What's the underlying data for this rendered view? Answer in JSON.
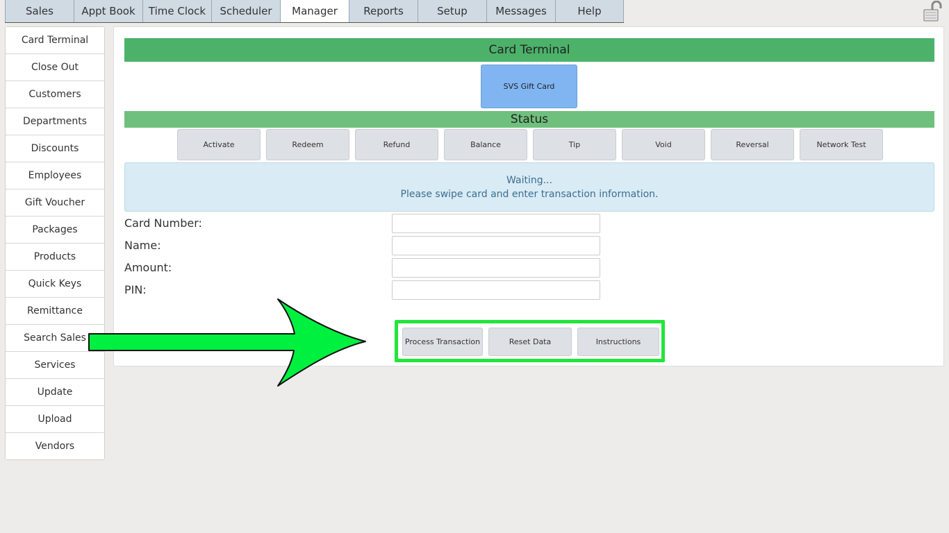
{
  "tabs": [
    {
      "label": "Sales"
    },
    {
      "label": "Appt Book"
    },
    {
      "label": "Time Clock"
    },
    {
      "label": "Scheduler"
    },
    {
      "label": "Manager"
    },
    {
      "label": "Reports"
    },
    {
      "label": "Setup"
    },
    {
      "label": "Messages"
    },
    {
      "label": "Help"
    }
  ],
  "active_tab": "Manager",
  "sidebar": {
    "items": [
      {
        "label": "Card Terminal"
      },
      {
        "label": "Close Out"
      },
      {
        "label": "Customers"
      },
      {
        "label": "Departments"
      },
      {
        "label": "Discounts"
      },
      {
        "label": "Employees"
      },
      {
        "label": "Gift Voucher"
      },
      {
        "label": "Packages"
      },
      {
        "label": "Products"
      },
      {
        "label": "Quick Keys"
      },
      {
        "label": "Remittance"
      },
      {
        "label": "Search Sales"
      },
      {
        "label": "Services"
      },
      {
        "label": "Update"
      },
      {
        "label": "Upload"
      },
      {
        "label": "Vendors"
      }
    ]
  },
  "main": {
    "title": "Card Terminal",
    "gift_card_button": "SVS Gift Card",
    "status_title": "Status",
    "actions": [
      {
        "label": "Activate"
      },
      {
        "label": "Redeem"
      },
      {
        "label": "Refund"
      },
      {
        "label": "Balance"
      },
      {
        "label": "Tip"
      },
      {
        "label": "Void"
      },
      {
        "label": "Reversal"
      },
      {
        "label": "Network Test"
      }
    ],
    "status_message": {
      "line1": "Waiting...",
      "line2": "Please swipe card and enter transaction information."
    },
    "form": {
      "card_number": {
        "label": "Card Number:",
        "value": ""
      },
      "name": {
        "label": "Name:",
        "value": ""
      },
      "amount": {
        "label": "Amount:",
        "value": ""
      },
      "pin": {
        "label": "PIN:",
        "value": ""
      }
    },
    "bottom_buttons": {
      "process": "Process Transaction",
      "reset": "Reset Data",
      "instructions": "Instructions"
    }
  },
  "colors": {
    "header_green": "#4cb26a",
    "status_green": "#6fc07d",
    "highlight_green": "#22e53c",
    "arrow_green": "#00f040",
    "gift_card_blue": "#80b5f2"
  },
  "icons": {
    "lock": "unlocked-padlock-icon",
    "annotation": "arrow-right-icon"
  }
}
